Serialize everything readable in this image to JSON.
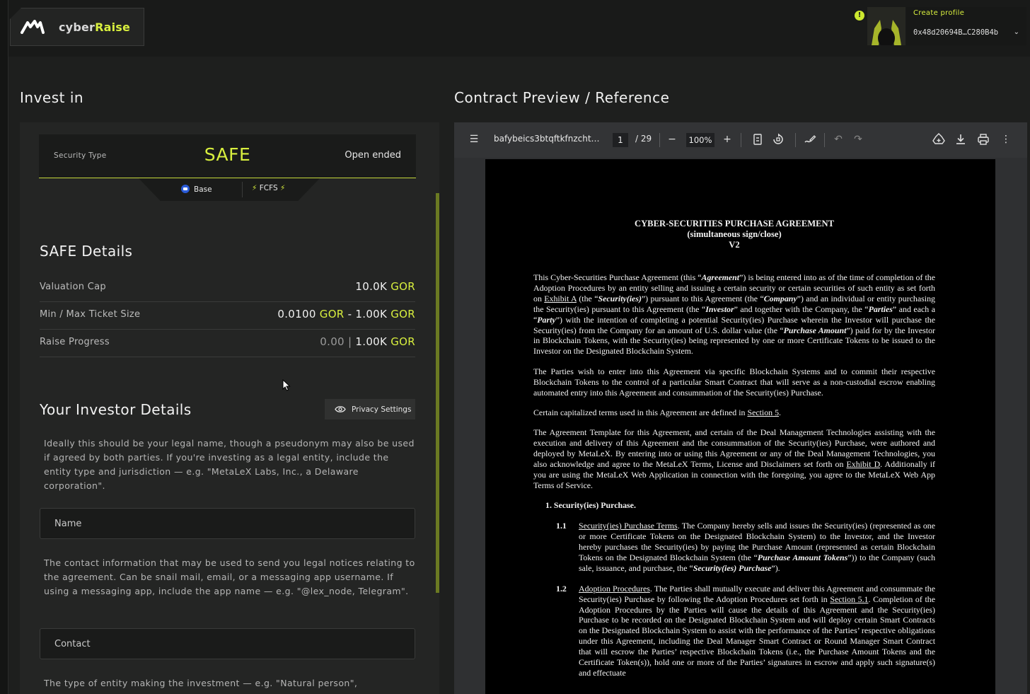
{
  "app": {
    "logo_text_a": "cyber",
    "logo_text_b": "Raise",
    "notify_badge": "!",
    "create_profile": "Create profile",
    "wallet_address": "0x48d20694B…C280B4b"
  },
  "left": {
    "heading": "Invest in",
    "security_type_label": "Security Type",
    "security_type": "SAFE",
    "term": "Open ended",
    "chain": "Base",
    "allocation": "FCFS",
    "safe_details_heading": "SAFE Details",
    "rows": [
      {
        "label": "Valuation Cap",
        "v1": "10.0K",
        "u1": "GOR"
      },
      {
        "label": "Min / Max Ticket Size",
        "v1": "0.0100",
        "u1": "GOR",
        "sep": "-",
        "v2": "1.00K",
        "u2": "GOR"
      },
      {
        "label": "Raise Progress",
        "v1": "0.00",
        "sep": "|",
        "v2": "1.00K",
        "u2": "GOR"
      }
    ],
    "investor_heading": "Your Investor Details",
    "privacy_button": "Privacy Settings",
    "name_help": "Ideally this should be your legal name, though a pseudonym may also be used if agreed by both parties. If you're investing as a legal entity, include the entity type and jurisdiction — e.g. \"MetaLeX Labs, Inc., a Delaware corporation\".",
    "name_placeholder": "Name",
    "contact_help": "The contact information that may be used to send you legal notices relating to the agreement. Can be snail mail, email, or a messaging app username. If using a messaging app, include the app name — e.g. \"@lex_node, Telegram\".",
    "contact_placeholder": "Contact",
    "entity_help": "The type of entity making the investment — e.g. \"Natural person\","
  },
  "right": {
    "heading": "Contract Preview / Reference",
    "file_name": "bafybeics3btqftkfnzcht…",
    "page_current": "1",
    "page_total": "/ 29",
    "zoom": "100%"
  },
  "doc": {
    "title_1": "CYBER-SECURITIES PURCHASE AGREEMENT",
    "title_2": "(simultaneous sign/close)",
    "title_3": "V2",
    "p1_a": "This Cyber-Securities Purchase Agreement (this “",
    "p1_b": "Agreement",
    "p1_c": "”) is being entered into as of the time of completion of the Adoption Procedures by an entity selling and issuing a certain security or certain securities of such entity as set forth on ",
    "p1_d": "Exhibit A",
    "p1_e": " (the “",
    "p1_f": "Security(ies)",
    "p1_g": "”) pursuant to this Agreement (the “",
    "p1_h": "Company",
    "p1_i": "”) and an individual or entity purchasing the Security(ies) pursuant to this Agreement (the “",
    "p1_j": "Investor",
    "p1_k": "” and together with the Company, the “",
    "p1_l": "Parties",
    "p1_m": "” and each a “",
    "p1_n": "Party",
    "p1_o": "”) with the intention of completing a potential Security(ies) Purchase wherein the Investor will purchase the Security(ies) from the Company for an amount of U.S. dollar value (the “",
    "p1_p": "Purchase Amount",
    "p1_q": "”) paid for by the Investor in Blockchain Tokens, with the Security(ies) being represented by one or more Certificate Tokens to be issued to the Investor on the Designated Blockchain System.",
    "p2": "The Parties wish to enter into this Agreement via specific Blockchain Systems and to commit their respective Blockchain Tokens to the control of a particular Smart Contract that will serve as a non-custodial escrow enabling automated entry into this Agreement and consummation of the Security(ies) Purchase.",
    "p3_a": "Certain capitalized terms used in this Agreement are defined in ",
    "p3_b": "Section 5",
    "p3_c": ".",
    "p4_a": "The Agreement Template for this Agreement, and certain of the Deal Management Technologies assisting with the execution and delivery of this Agreement and the consummation of the Security(ies) Purchase, were authored and deployed by MetaLeX. By entering into or using this Agreement or any of the Deal Management Technologies, you also acknowledge and agree to the MetaLeX Terms, License and Disclaimers set forth on ",
    "p4_b": "Exhibit D",
    "p4_c": ". Additionally if you are using the MetaLeX Web Application in connection with the foregoing, you agree to the MetaLeX Web App Terms of Service.",
    "s1": "1.  Security(ies) Purchase.",
    "s11_num": "1.1",
    "s11_a": "Security(ies) Purchase Terms",
    "s11_b": ". The Company hereby sells and issues the Security(ies) (represented as one or more Certificate Tokens on the Designated Blockchain System) to the Investor, and the Investor hereby purchases the Security(ies) by paying the Purchase Amount (represented as certain Blockchain Tokens on the Designated Blockchain System (the “",
    "s11_c": "Purchase Amount Tokens",
    "s11_d": "”)) to the Company (such sale, issuance, and purchase, the “",
    "s11_e": "Security(ies) Purchase",
    "s11_f": "”).",
    "s12_num": "1.2",
    "s12_a": "Adoption Procedures",
    "s12_b": ". The Parties shall mutually execute and deliver this Agreement and consummate the Security(ies) Purchase by following the Adoption Procedures set forth in ",
    "s12_c": "Section 5.1",
    "s12_d": ". Completion of the Adoption Procedures by the Parties will cause the details of this Agreement and the Security(ies) Purchase to be recorded on the Designated Blockchain System and will deploy certain Smart Contracts on the Designated Blockchain System to assist with the performance of the Parties’ respective obligations under this Agreement, including the Deal Manager Smart Contract or Round Manager Smart Contract that will escrow the Parties’ respective Blockchain Tokens (i.e., the Purchase Amount Tokens and the Certificate Token(s)), hold one or more of the Parties’ signatures in escrow and apply such signature(s) and effectuate"
  }
}
